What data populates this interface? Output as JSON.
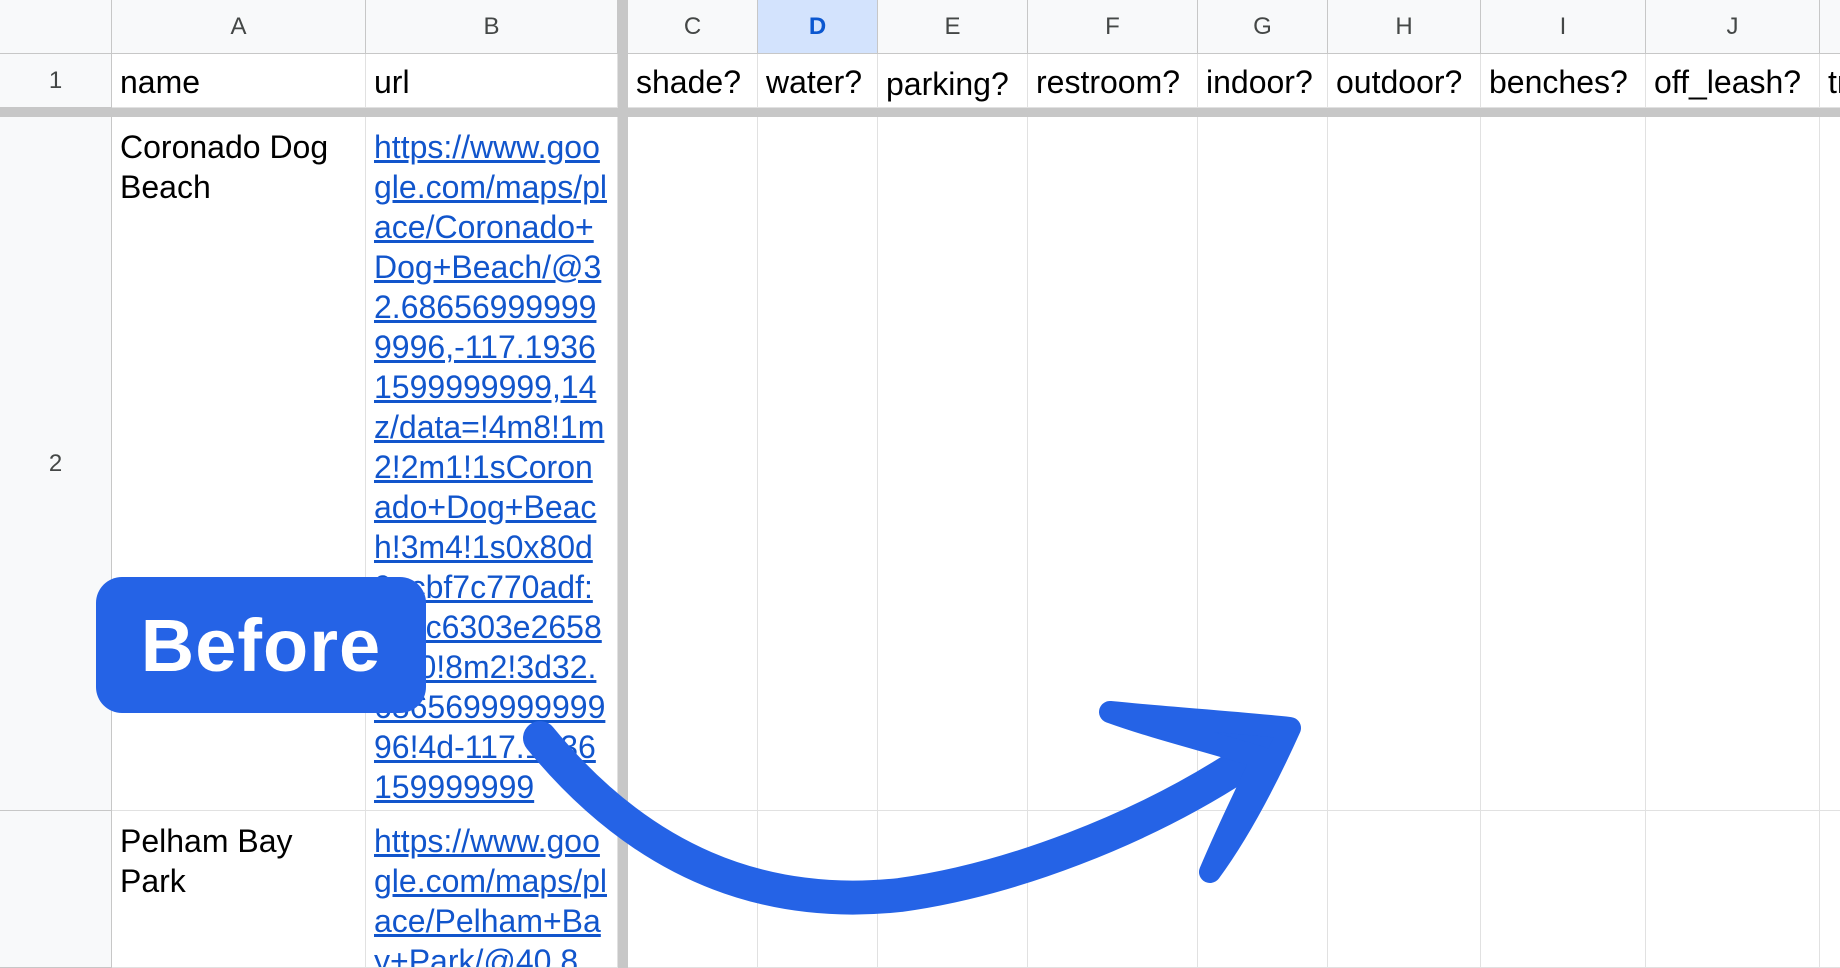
{
  "columns": [
    "A",
    "B",
    "C",
    "D",
    "E",
    "F",
    "G",
    "H",
    "I",
    "J"
  ],
  "active_column": "D",
  "rows": [
    "1",
    "2"
  ],
  "headers": [
    "name",
    "url",
    "shade?",
    "water?",
    "parking?",
    "restroom?",
    "indoor?",
    "outdoor?",
    "benches?",
    "off_leash?",
    "tr"
  ],
  "records": [
    {
      "name": "Coronado Dog Beach",
      "url": "https://www.google.com/maps/place/Coronado+Dog+Beach/@32.686569999999996,-117.19361599999999,14z/data=!4m8!1m2!2m1!1sCoronado+Dog+Beach!3m4!1s0x80d9acbf7c770adf:0x1c6303e2658f8e0!8m2!3d32.686569999999996!4d-117.1936159999999"
    },
    {
      "name": "Pelham Bay Park",
      "url": "https://www.google.com/maps/place/Pelham+Bay+Park/@40.8"
    }
  ],
  "badge": {
    "label": "Before"
  },
  "colors": {
    "accent": "#2563e6",
    "link": "#1155cc",
    "active_header": "#d3e3fd"
  }
}
